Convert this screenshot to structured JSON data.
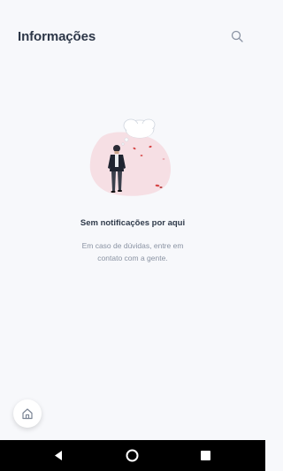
{
  "header": {
    "title": "Informações",
    "search_icon": "search-icon"
  },
  "empty_state": {
    "title": "Sem notificações por aqui",
    "description": "Em caso de dúvidas, entre em contato com a gente."
  },
  "fab": {
    "icon": "home-icon"
  },
  "navigation_bar": {
    "back_icon": "back-triangle-icon",
    "home_icon": "home-circle-icon",
    "recents_icon": "recents-square-icon"
  },
  "colors": {
    "background": "#f7f8fb",
    "title": "#2d3748",
    "muted": "#8a93a3",
    "accent_pink": "#f6dfe4",
    "accent_red": "#d64545"
  }
}
